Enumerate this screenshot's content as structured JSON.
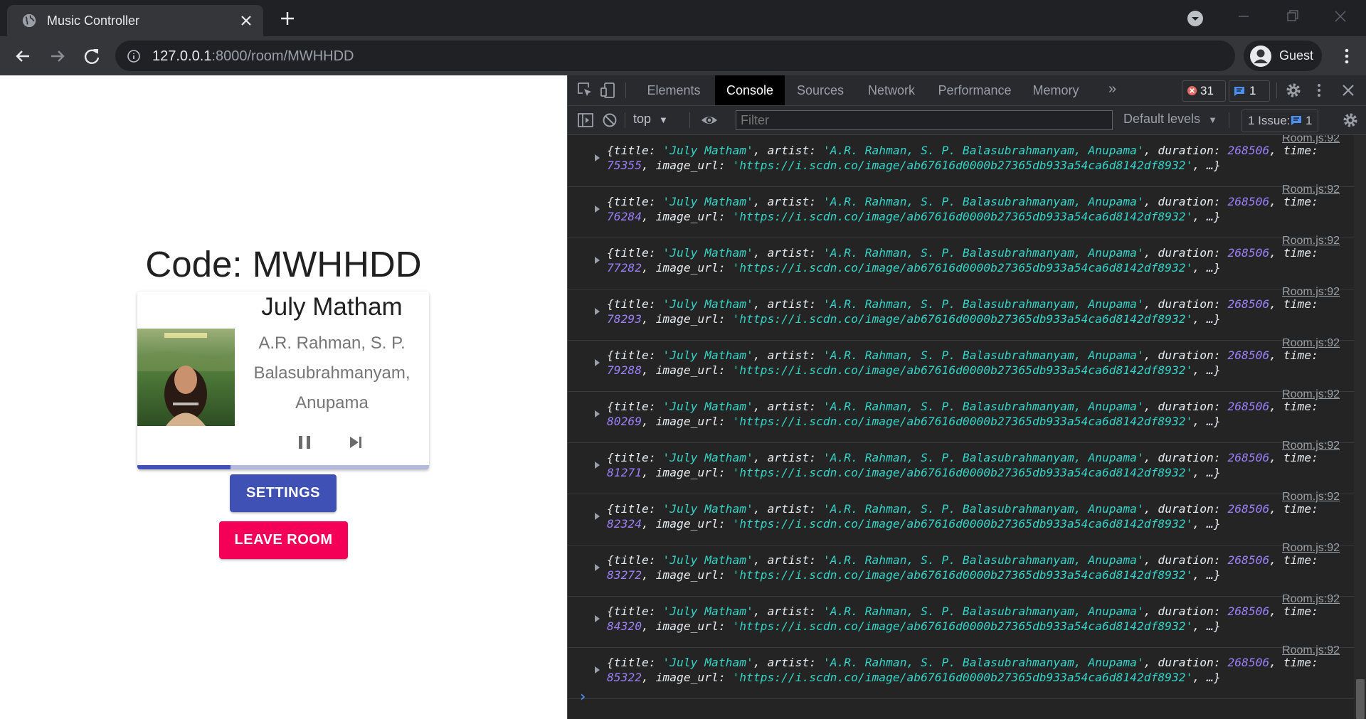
{
  "browser": {
    "tab_title": "Music Controller",
    "url_host": "127.0.0.1",
    "url_rest": ":8000/room/MWHHDD",
    "profile_label": "Guest"
  },
  "room": {
    "code_text": "Code: MWHHDD",
    "song": {
      "title": "July Matham",
      "artist": "A.R. Rahman, S. P. Balasubrahmanyam, Anupama",
      "progress_fraction": 0.32
    },
    "settings_label": "SETTINGS",
    "leave_label": "LEAVE ROOM"
  },
  "devtools": {
    "tabs": [
      "Elements",
      "Console",
      "Sources",
      "Network",
      "Performance",
      "Memory"
    ],
    "active_tab": "Console",
    "error_count": "31",
    "message_count": "1",
    "context": "top",
    "filter_placeholder": "Filter",
    "levels_label": "Default levels",
    "issues_label": "1 Issue:",
    "issues_count": "1"
  },
  "console": {
    "source": "Room.js:92",
    "entries": [
      {
        "time": "75355"
      },
      {
        "time": "76284"
      },
      {
        "time": "77282"
      },
      {
        "time": "78293"
      },
      {
        "time": "79288"
      },
      {
        "time": "80269"
      },
      {
        "time": "81271"
      },
      {
        "time": "82324"
      },
      {
        "time": "83272"
      },
      {
        "time": "84320"
      },
      {
        "time": "85322"
      }
    ],
    "obj_title": "'July Matham'",
    "obj_artist": "'A.R. Rahman, S. P. Balasubrahmanyam, Anupama'",
    "obj_duration": "268506",
    "obj_image_url": "'https://i.scdn.co/image/ab67616d0000b27365db933a54ca6d8142df8932'"
  },
  "colors": {
    "primary": "#3f51b5",
    "secondary": "#f50057",
    "console_string": "#35d4c7",
    "console_number": "#9980ff"
  }
}
